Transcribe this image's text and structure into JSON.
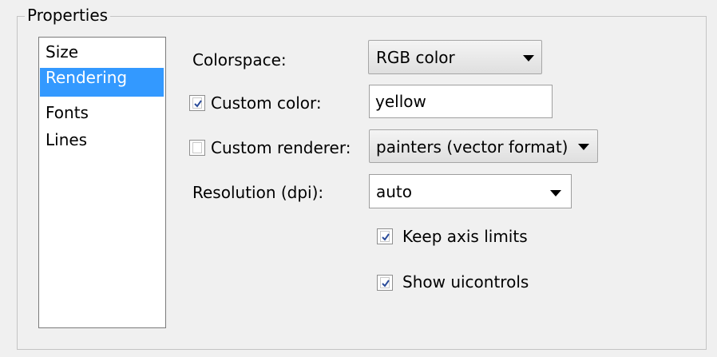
{
  "group": {
    "title": "Properties"
  },
  "list": {
    "items": [
      {
        "label": "Size",
        "selected": false
      },
      {
        "label": "Rendering",
        "selected": true
      },
      {
        "label": "Fonts",
        "selected": false
      },
      {
        "label": "Lines",
        "selected": false
      }
    ]
  },
  "form": {
    "colorspace_label": "Colorspace:",
    "colorspace_value": "RGB color",
    "custom_color_label": "Custom color:",
    "custom_color_checked": true,
    "custom_color_value": "yellow",
    "custom_renderer_label": "Custom renderer:",
    "custom_renderer_checked": false,
    "custom_renderer_value": "painters (vector format)",
    "resolution_label": "Resolution (dpi):",
    "resolution_value": "auto",
    "keep_axis_limits_label": "Keep axis limits",
    "keep_axis_limits_checked": true,
    "show_uicontrols_label": "Show uicontrols",
    "show_uicontrols_checked": true
  },
  "colors": {
    "selection": "#3399ff",
    "window_background": "#f0f0f0"
  },
  "icons": {
    "dropdown": "chevron-down-icon",
    "checkmark": "checkmark-icon"
  }
}
